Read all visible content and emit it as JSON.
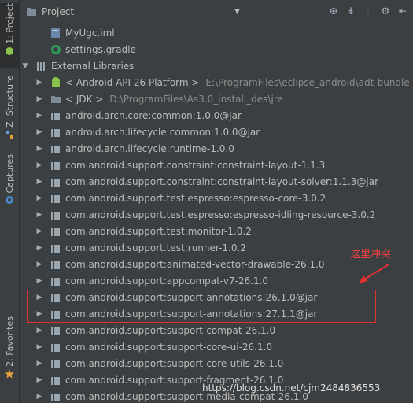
{
  "sidebar": {
    "tabs": [
      {
        "label": "1: Project"
      },
      {
        "label": "Z: Structure"
      },
      {
        "label": "Captures"
      },
      {
        "label": "2: Favorites"
      }
    ]
  },
  "header": {
    "title": "Project"
  },
  "tree": {
    "files": [
      {
        "label": "MyUgc.iml"
      },
      {
        "label": "settings.gradle"
      }
    ],
    "external_libraries": "External Libraries",
    "platform": {
      "label": "< Android API 26 Platform >",
      "path": "E:\\ProgramFiles\\eclipse_android\\adt-bundle-w"
    },
    "jdk": {
      "label": "< JDK >",
      "path": "D:\\ProgramFiles\\As3.0_install_des\\jre"
    },
    "libraries": [
      "android.arch.core:common:1.0.0@jar",
      "android.arch.lifecycle:common:1.0.0@jar",
      "android.arch.lifecycle:runtime-1.0.0",
      "com.android.support.constraint:constraint-layout-1.1.3",
      "com.android.support.constraint:constraint-layout-solver:1.1.3@jar",
      "com.android.support.test.espresso:espresso-core-3.0.2",
      "com.android.support.test.espresso:espresso-idling-resource-3.0.2",
      "com.android.support.test:monitor-1.0.2",
      "com.android.support.test:runner-1.0.2",
      "com.android.support:animated-vector-drawable-26.1.0",
      "com.android.support:appcompat-v7-26.1.0",
      "com.android.support:support-annotations:26.1.0@jar",
      "com.android.support:support-annotations:27.1.1@jar",
      "com.android.support:support-compat-26.1.0",
      "com.android.support:support-core-ui-26.1.0",
      "com.android.support:support-core-utils-26.1.0",
      "com.android.support:support-fragment-26.1.0",
      "com.android.support:support-media-compat-26.1.0"
    ]
  },
  "annotation": "这里冲突",
  "watermark": "https://blog.csdn.net/cjm2484836553",
  "colors": {
    "conflict": "#e03030",
    "background": "#3c3f41"
  }
}
